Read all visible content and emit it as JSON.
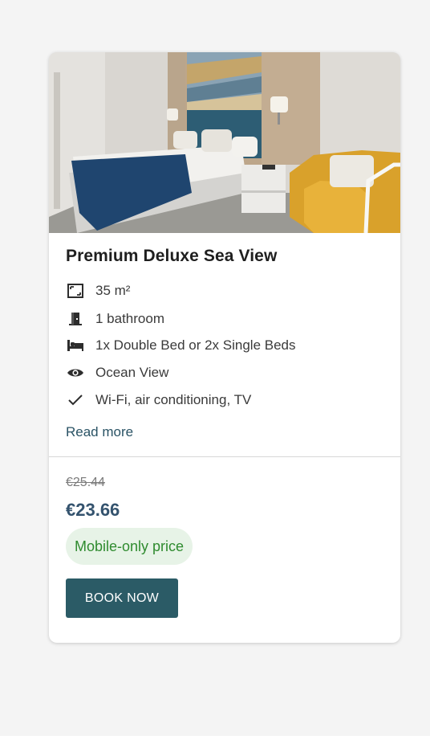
{
  "room": {
    "title": "Premium Deluxe Sea View",
    "features": [
      {
        "icon": "room-size-icon",
        "label": "35 m²"
      },
      {
        "icon": "door-icon",
        "label": "1 bathroom"
      },
      {
        "icon": "bed-icon",
        "label": "1x Double Bed or 2x Single Beds"
      },
      {
        "icon": "eye-icon",
        "label": "Ocean View"
      },
      {
        "icon": "check-icon",
        "label": "Wi-Fi, air conditioning, TV"
      }
    ],
    "read_more": "Read more"
  },
  "pricing": {
    "old_price": "€25.44",
    "new_price": "€23.66",
    "badge": "Mobile-only price",
    "book_label": "BOOK NOW"
  },
  "colors": {
    "accent": "#2b5b66",
    "price": "#34536e",
    "badge_bg": "#e7f3e7",
    "badge_text": "#2f8b2f",
    "link": "#2a5365"
  }
}
